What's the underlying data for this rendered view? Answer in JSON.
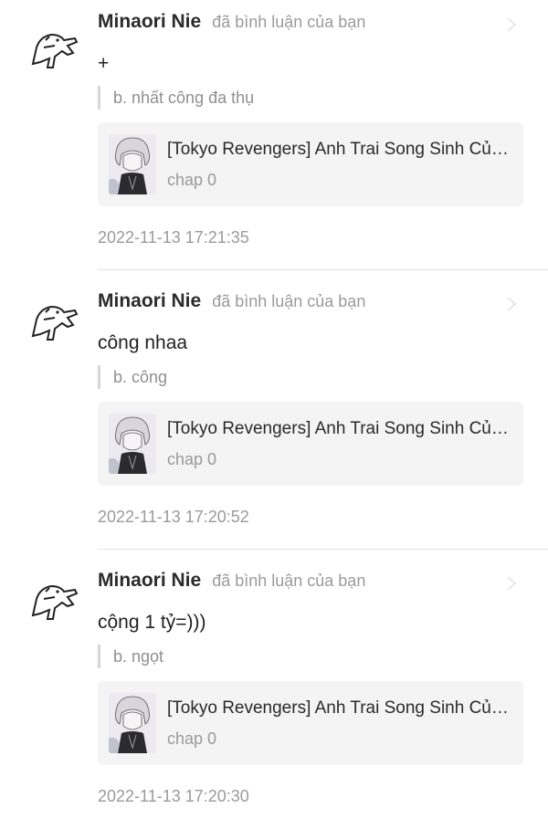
{
  "notifications": [
    {
      "user_name": "Minaori Nie",
      "action_text": "đã bình luận của bạn",
      "comment": "+",
      "quote": "b. nhất công đa thụ",
      "story_title": "[Tokyo Revengers] Anh Trai Song Sinh Của Tôi",
      "chapter": "chap 0",
      "timestamp": "2022-11-13 17:21:35"
    },
    {
      "user_name": "Minaori Nie",
      "action_text": "đã bình luận của bạn",
      "comment": "công nhaa",
      "quote": "b. công",
      "story_title": "[Tokyo Revengers] Anh Trai Song Sinh Của Tôi",
      "chapter": "chap 0",
      "timestamp": "2022-11-13 17:20:52"
    },
    {
      "user_name": "Minaori Nie",
      "action_text": "đã bình luận của bạn",
      "comment": "cộng 1 tỷ=)))",
      "quote": "b. ngọt",
      "story_title": "[Tokyo Revengers] Anh Trai Song Sinh Của Tôi",
      "chapter": "chap 0",
      "timestamp": "2022-11-13 17:20:30"
    }
  ]
}
